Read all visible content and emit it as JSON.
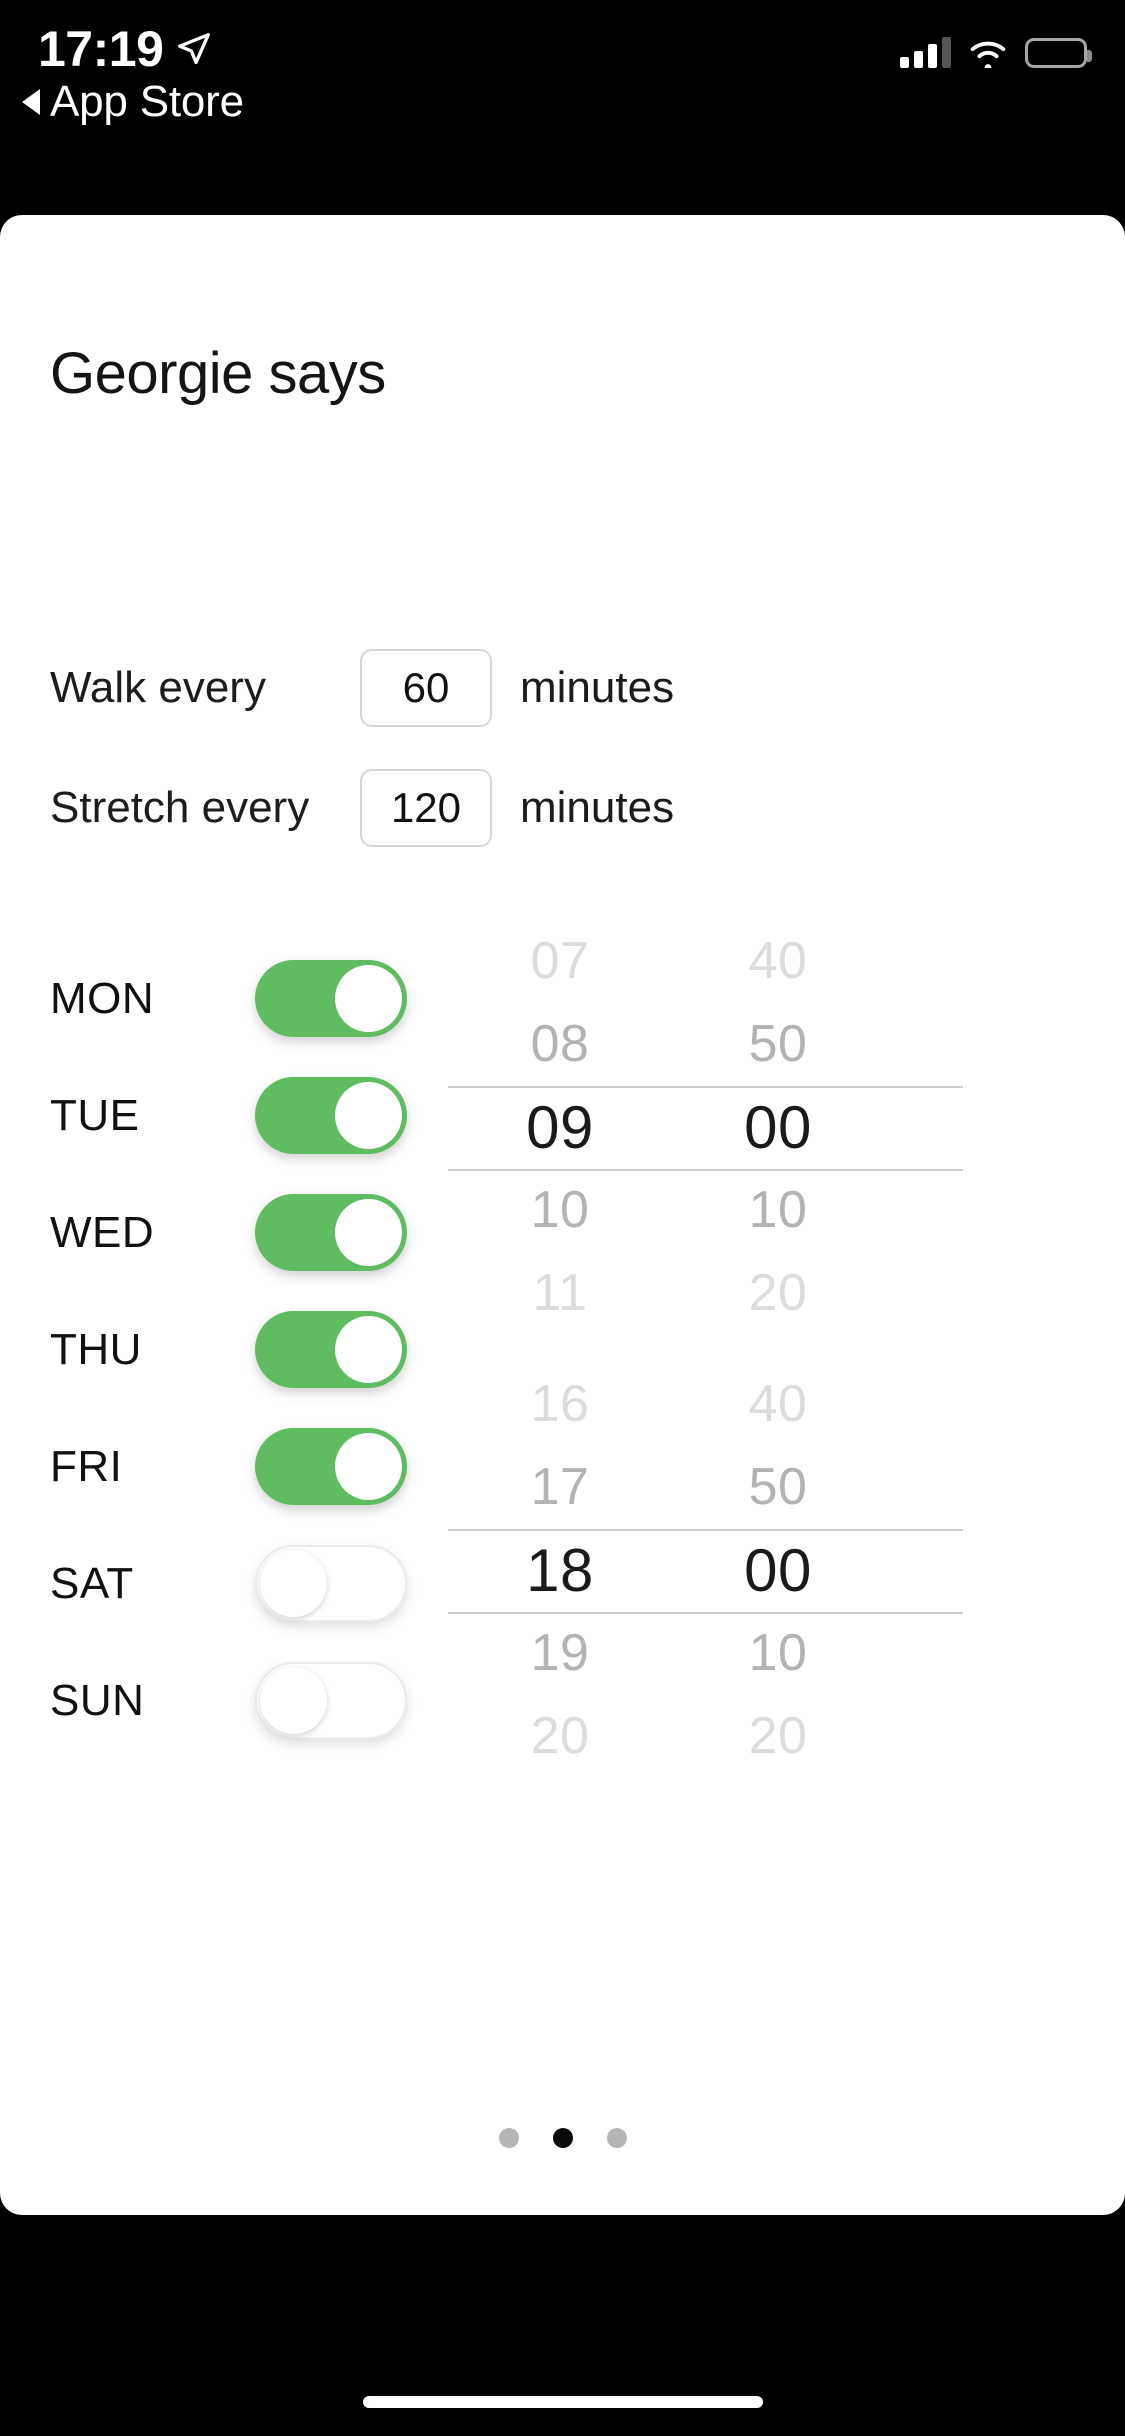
{
  "status_bar": {
    "time": "17:19",
    "location_arrow_icon": "location-arrow-icon",
    "back_label": "App Store",
    "back_caret_icon": "back-caret-icon",
    "cellular_icon": "cellular-signal-icon",
    "cellular_bars_filled": 3,
    "cellular_bars_total": 4,
    "wifi_icon": "wifi-icon",
    "battery_icon": "battery-icon",
    "battery_full": true
  },
  "main": {
    "title": "Georgie says",
    "intervals": [
      {
        "label": "Walk every",
        "value": "60",
        "placeholder": "60",
        "unit": "minutes"
      },
      {
        "label": "Stretch every",
        "value": "120",
        "placeholder": "120",
        "unit": "minutes"
      }
    ],
    "days": [
      {
        "label": "MON",
        "enabled": true
      },
      {
        "label": "TUE",
        "enabled": true
      },
      {
        "label": "WED",
        "enabled": true
      },
      {
        "label": "THU",
        "enabled": true
      },
      {
        "label": "FRI",
        "enabled": true
      },
      {
        "label": "SAT",
        "enabled": false
      },
      {
        "label": "SUN",
        "enabled": false
      }
    ],
    "pickers": [
      {
        "name": "start-time",
        "hours": [
          "07",
          "08",
          "09",
          "10",
          "11"
        ],
        "minutes": [
          "40",
          "50",
          "00",
          "10",
          "20"
        ],
        "selected_hour": "09",
        "selected_minute": "00",
        "selected_index": 2
      },
      {
        "name": "end-time",
        "hours": [
          "16",
          "17",
          "18",
          "19",
          "20"
        ],
        "minutes": [
          "40",
          "50",
          "00",
          "10",
          "20"
        ],
        "selected_hour": "18",
        "selected_minute": "00",
        "selected_index": 2
      }
    ],
    "page_dots": {
      "count": 3,
      "active_index": 1
    }
  },
  "colors": {
    "toggle_on": "#5fbc60",
    "toggle_off_track": "#ffffff",
    "picker_selected_text": "#1a1a1a",
    "picker_dim_text": "#b3b3b3",
    "dot_active": "#0a0a0a",
    "dot_inactive": "#b6b6b6",
    "screen_background": "#000000",
    "card_background": "#ffffff"
  }
}
